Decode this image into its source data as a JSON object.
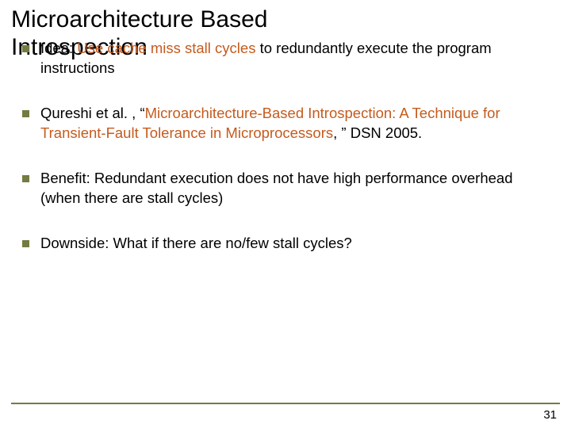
{
  "title_line1": "Microarchitecture Based",
  "title_line2": "Introspection",
  "bullets": [
    {
      "prefix": "Idea: ",
      "highlight": "Use cache miss stall cycles",
      "suffix": " to redundantly execute the program instructions"
    },
    {
      "prefix": "Qureshi et al. , “",
      "highlight": "Microarchitecture-Based Introspection: A Technique for Transient-Fault Tolerance in Microprocessors",
      "suffix": ", ” DSN 2005."
    },
    {
      "prefix": "Benefit: Redundant execution does not have high performance overhead (when there are stall cycles)",
      "highlight": "",
      "suffix": ""
    },
    {
      "prefix": "Downside: What if there are no/few stall cycles?",
      "highlight": "",
      "suffix": ""
    }
  ],
  "page_number": "31"
}
